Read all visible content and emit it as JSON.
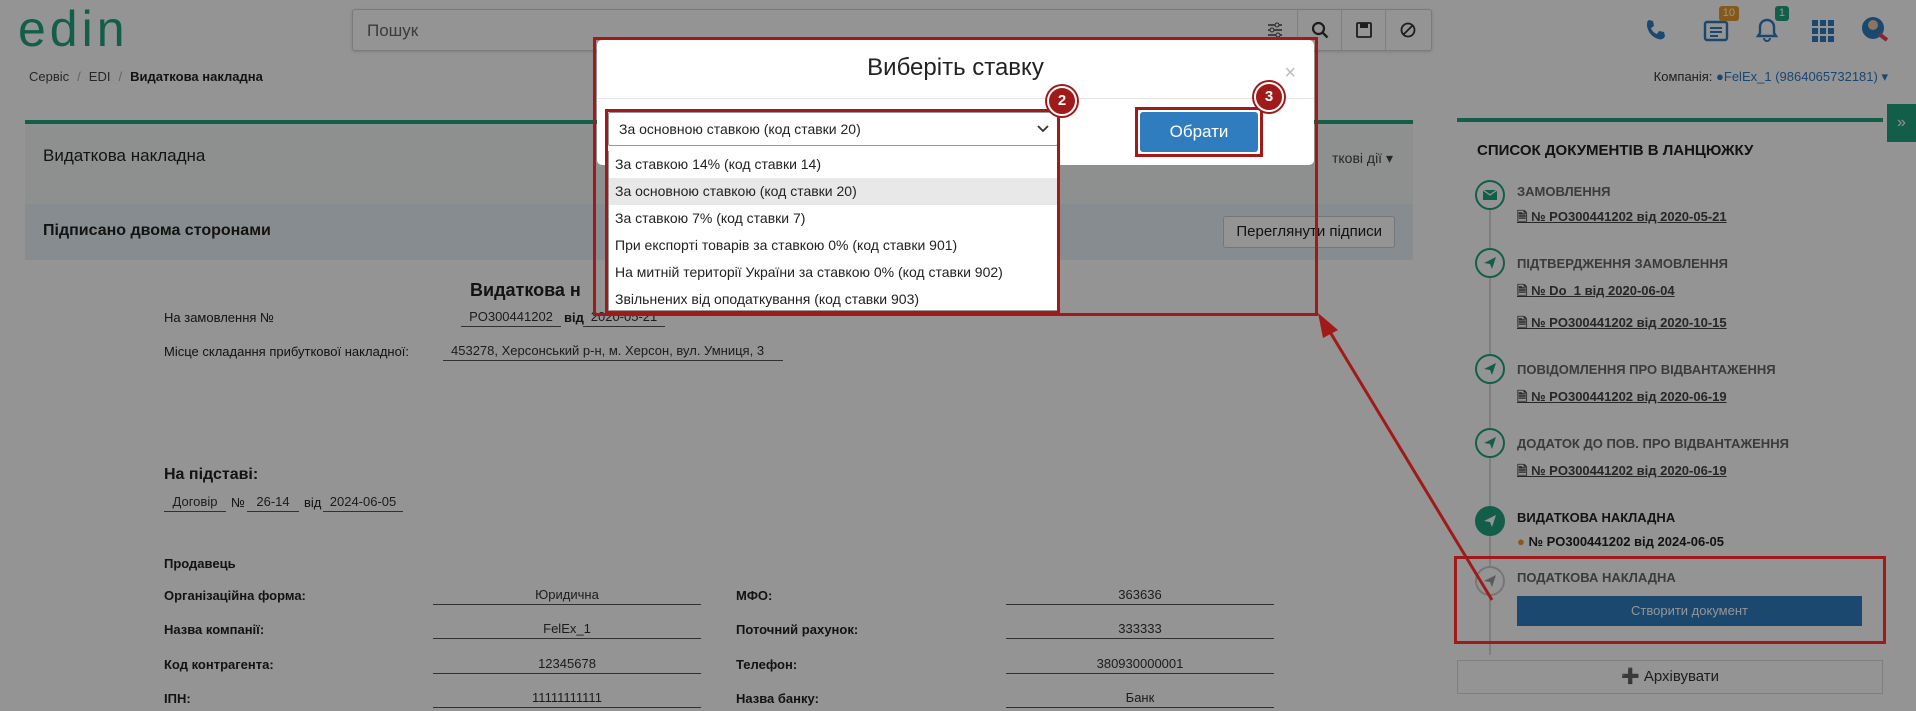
{
  "header": {
    "logo_text": "edin",
    "search_placeholder": "Пошук",
    "badges": {
      "documents": "10",
      "notifications": "1"
    }
  },
  "breadcrumbs": {
    "items": [
      "Сервіс",
      "EDI"
    ],
    "current": "Видаткова накладна"
  },
  "company": {
    "label": "Компанія:",
    "value": "FelEx_1 (9864065732181)"
  },
  "document": {
    "title": "Видаткова накладна",
    "actions_label": "ткові дії",
    "status": "Підписано двома сторонами",
    "view_signatures": "Переглянути підписи",
    "heading": "Видаткова н",
    "order_label": "На замовлення №",
    "order_number": "PO300441202",
    "from_label": "від",
    "order_date": "2020-05-21",
    "place_label": "Місце складання прибуткової накладної:",
    "place_value": "453278, Херсонський р-н, м. Херсон, вул. Умниця, 3",
    "basis_label": "На підставі:",
    "basis_type": "Договір",
    "basis_no_label": "№",
    "basis_number": "26-14",
    "basis_from_label": "від",
    "basis_date": "2024-06-05",
    "seller_label": "Продавець",
    "left_fields": [
      {
        "label": "Організаційна форма:",
        "value": "Юридична"
      },
      {
        "label": "Назва компанії:",
        "value": "FelEx_1"
      },
      {
        "label": "Код контрагента:",
        "value": "12345678"
      },
      {
        "label": "ІПН:",
        "value": "11111111111"
      }
    ],
    "right_fields": [
      {
        "label": "МФО:",
        "value": "363636"
      },
      {
        "label": "Поточний рахунок:",
        "value": "333333"
      },
      {
        "label": "Телефон:",
        "value": "380930000001"
      },
      {
        "label": "Назва банку:",
        "value": "Банк"
      }
    ]
  },
  "chain": {
    "title": "СПИСОК ДОКУМЕНТІВ В ЛАНЦЮЖКУ",
    "items": [
      {
        "name": "ЗАМОВЛЕННЯ",
        "links": [
          "№ PO300441202 від 2020-05-21"
        ]
      },
      {
        "name": "ПІДТВЕРДЖЕННЯ ЗАМОВЛЕННЯ",
        "links": [
          "№ Do_1 від 2020-06-04",
          "№ PO300441202 від 2020-10-15"
        ]
      },
      {
        "name": "ПОВІДОМЛЕННЯ ПРО ВІДВАНТАЖЕННЯ",
        "links": [
          "№ PO300441202 від 2020-06-19"
        ]
      },
      {
        "name": "ДОДАТОК ДО ПОВ. ПРО ВІДВАНТАЖЕННЯ",
        "links": [
          "№ PO300441202 від 2020-06-19"
        ]
      },
      {
        "name": "ВИДАТКОВА НАКЛАДНА",
        "links": [
          "№ PO300441202 від 2024-06-05"
        ]
      },
      {
        "name": "ПОДАТКОВА НАКЛАДНА",
        "links": []
      }
    ],
    "create_button": "Створити документ",
    "archive_button": "Архівувати"
  },
  "modal": {
    "title": "Виберіть ставку",
    "close": "×",
    "selected": "За основною ставкою (код ставки 20)",
    "options": [
      "За ставкою 14% (код ставки 14)",
      "За основною ставкою (код ставки 20)",
      "За ставкою 7% (код ставки 7)",
      "При експорті товарів за ставкою 0% (код ставки 901)",
      "На митній території України за ставкою 0% (код ставки 902)",
      "Звільнених від оподаткування (код ставки 903)"
    ],
    "choose_button": "Обрати"
  },
  "annotations": {
    "step2": "2",
    "step3": "3"
  },
  "colors": {
    "accent": "#1fa37e",
    "primary": "#2f7dbf",
    "annotation": "#a11a1a"
  }
}
